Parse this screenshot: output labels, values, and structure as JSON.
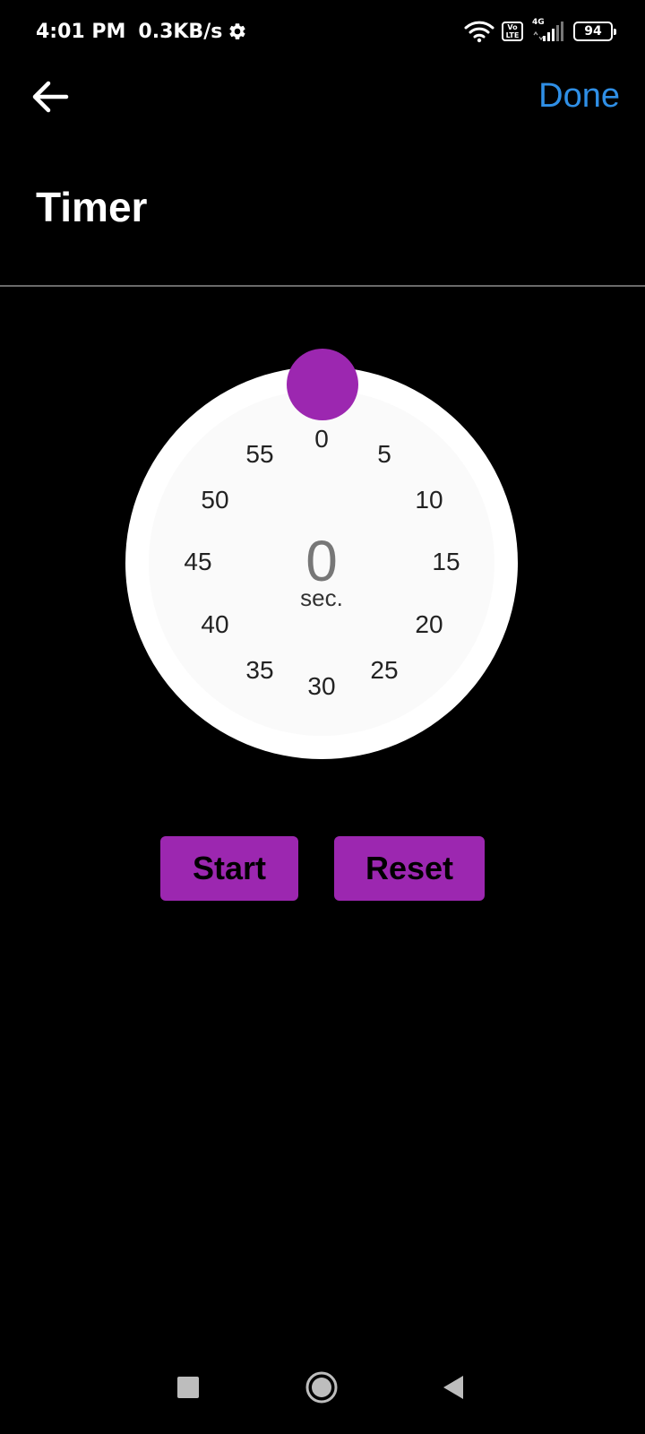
{
  "status_bar": {
    "time": "4:01 PM",
    "speed": "0.3KB/s",
    "network_type": "4G",
    "volte_top": "Vo",
    "volte_bottom": "LTE",
    "battery": "94",
    "icons": [
      "settings-gear-icon",
      "wifi-icon",
      "volte-icon",
      "signal-icon",
      "battery-icon"
    ]
  },
  "app_bar": {
    "back_icon": "arrow-left-icon",
    "done_label": "Done",
    "done_color": "#2f8fe6"
  },
  "page": {
    "title": "Timer"
  },
  "dial": {
    "numbers": [
      "0",
      "5",
      "10",
      "15",
      "20",
      "25",
      "30",
      "35",
      "40",
      "45",
      "50",
      "55"
    ],
    "value": "0",
    "unit": "sec.",
    "handle_color": "#9c27b0",
    "handle_value_seconds": 0
  },
  "controls": {
    "start_label": "Start",
    "reset_label": "Reset",
    "button_color": "#9c27b0"
  },
  "nav_bar": {
    "icons": [
      "recents-square-icon",
      "home-circle-icon",
      "back-triangle-icon"
    ]
  }
}
